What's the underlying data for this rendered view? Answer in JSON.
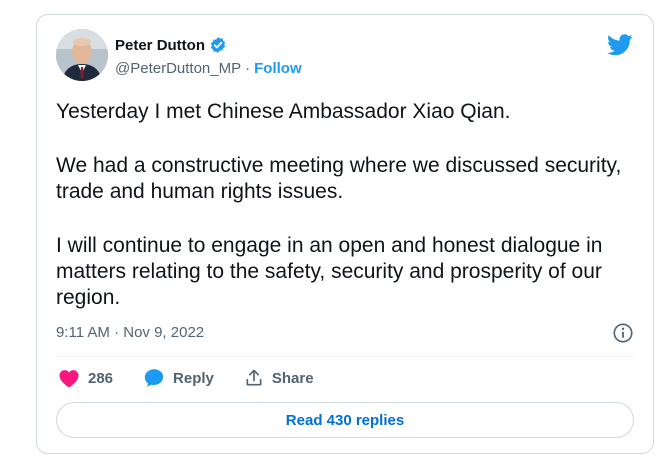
{
  "author": {
    "name": "Peter Dutton",
    "handle": "@PeterDutton_MP",
    "separator": "·",
    "follow_label": "Follow"
  },
  "tweet": {
    "paragraphs": [
      "Yesterday I met Chinese Ambassador Xiao Qian.",
      "We had a constructive meeting where we discussed security, trade and human rights issues.",
      "I will continue to engage in an open and honest dialogue in matters relating to the safety, security and prosperity of our region."
    ],
    "timestamp": "9:11 AM · Nov 9, 2022"
  },
  "actions": {
    "likes_count": "286",
    "reply_label": "Reply",
    "share_label": "Share"
  },
  "read_replies_label": "Read 430 replies",
  "icons": [
    "avatar",
    "verified-badge-icon",
    "twitter-bird-icon",
    "info-icon",
    "heart-icon",
    "reply-bubble-icon",
    "share-icon"
  ],
  "colors": {
    "accent": "#1d9bf0",
    "like": "#f91880",
    "text": "#0f1419",
    "muted": "#536471",
    "border": "#cfd9de",
    "link": "#006fd6"
  }
}
